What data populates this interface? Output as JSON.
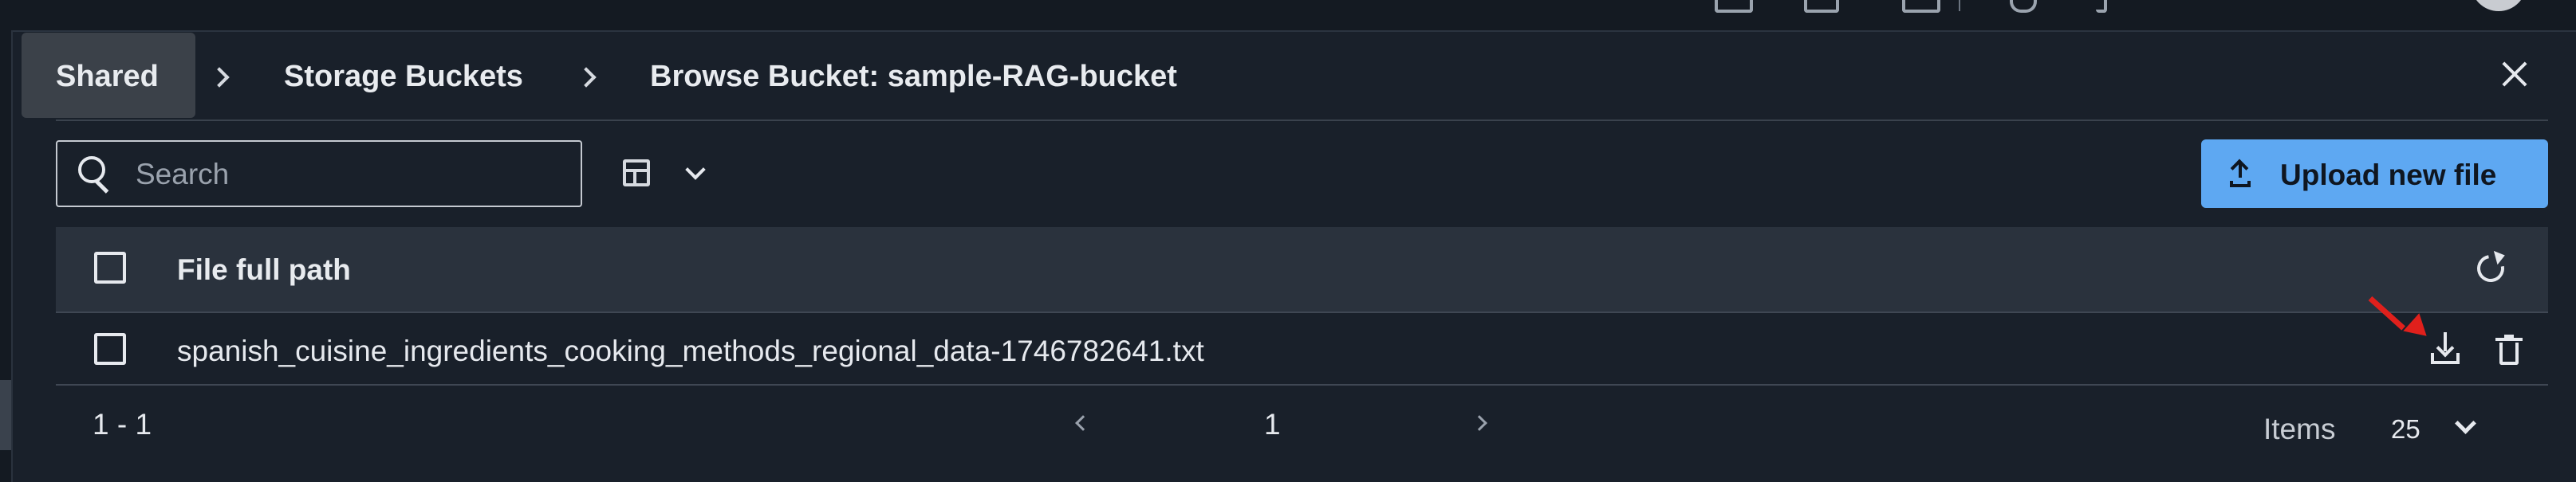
{
  "breadcrumb": {
    "items": [
      "Shared",
      "Storage Buckets",
      "Browse Bucket: sample-RAG-bucket"
    ]
  },
  "toolbar": {
    "search_placeholder": "Search",
    "upload_label": "Upload new file"
  },
  "table": {
    "column_header": "File full path",
    "rows": [
      {
        "path": "spanish_cuisine_ingredients_cooking_methods_regional_data-1746782641.txt"
      }
    ]
  },
  "pagination": {
    "range": "1 - 1",
    "current_page": "1",
    "items_label": "Items",
    "page_size": "25"
  },
  "icons": {
    "search": "search-icon",
    "table_settings": "table-icon",
    "upload": "upload-icon",
    "refresh": "refresh-icon",
    "download": "download-icon",
    "delete": "trash-icon",
    "close": "close-icon"
  },
  "colors": {
    "background": "#19202a",
    "header_row": "#2a323d",
    "primary_button": "#5ea8f2",
    "annotation_arrow": "#e0201c"
  }
}
